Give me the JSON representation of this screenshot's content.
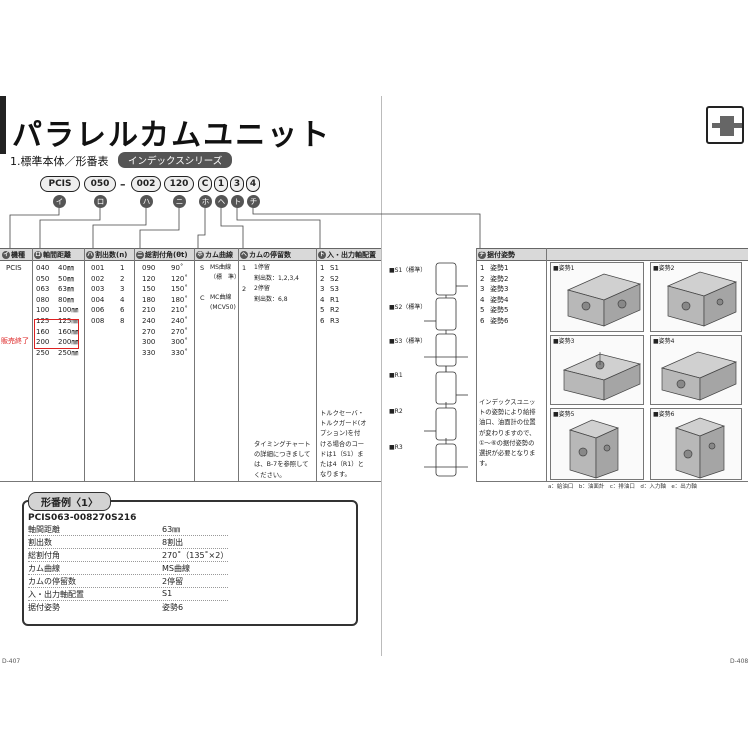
{
  "header": {
    "title": "パラレルカムユニット",
    "subtitle": "1.標準本体／形番表",
    "series_badge": "インデックスシリーズ"
  },
  "code": {
    "parts": [
      "PCIS",
      "050",
      "002",
      "120",
      "C",
      "1",
      "3",
      "4"
    ],
    "dash": "–",
    "markers": [
      "イ",
      "ロ",
      "ハ",
      "ニ",
      "ホ",
      "ヘ",
      "ト",
      "チ"
    ]
  },
  "table": {
    "headers": {
      "kind": "機種",
      "center": "軸間距離",
      "div": "割出数(n)",
      "angle": "総割付角(θt)",
      "curve": "カム曲線",
      "stops": "カムの停留数",
      "io": "入・出力軸配置",
      "mount": "据付姿勢"
    },
    "kind": "PCIS",
    "center_codes": "040\n050\n063\n080\n100\n125\n160\n200\n250",
    "center_values": "40㎜\n50㎜\n63㎜\n80㎜\n100㎜\n125㎜\n160㎜\n200㎜\n250㎜",
    "div_codes": "001\n002\n003\n004\n006\n008",
    "div_values": "1\n2\n3\n4\n6\n8",
    "angle_codes": "090\n120\n150\n180\n210\n240\n270\n300\n330",
    "angle_values": "90˚\n120˚\n150˚\n180˚\n210˚\n240˚\n270˚\n300˚\n330˚",
    "curve_codes": "S\n\n\nC",
    "curve_values": "MS曲線\n（標　準）\n\nMC曲線\n(MCV50)",
    "stop_codes": "1\n\n2",
    "stop_values": "1停留\n割出数：1,2,3,4\n2停留\n割出数：6,8",
    "stop_note": "タイミングチャート\nの詳細につきまして\nは、B-7を参照して\nください。",
    "io_codes": "1\n2\n3\n4\n5\n6",
    "io_values": "S1\nS2\nS3\nR1\nR2\nR3",
    "io_note": "トルクセーバ・\nトルクガード(オ\nプション)を付\nける場合のコー\nドは1（S1）ま\nたは4（R1）と\nなります。",
    "mount_codes": "1\n2\n3\n4\n5\n6",
    "mount_values": "姿勢1\n姿勢2\n姿勢3\n姿勢4\n姿勢5\n姿勢6",
    "mount_note": "インデックスユニッ\nトの姿勢により給排\n油口、油面計の位置\nが変わりますので、\n①～⑥の据付姿勢の\n選択が必要となりま\nす。",
    "sold_out": "販売終了"
  },
  "configs": [
    "■S1（標準）",
    "■S2（標準）",
    "■S3（標準）",
    "■R1",
    "■R2",
    "■R3"
  ],
  "postures": [
    "■姿勢1",
    "■姿勢2",
    "■姿勢3",
    "■姿勢4",
    "■姿勢5",
    "■姿勢6"
  ],
  "posture_legend": "a：給油口　b：油面計　c：排油口　d：入力軸　e：出力軸",
  "example": {
    "tab": "形番例〈1〉",
    "code": "PCIS063-008270S216",
    "rows": [
      {
        "label": "軸間距離",
        "value": "63㎜"
      },
      {
        "label": "割出数",
        "value": "8割出"
      },
      {
        "label": "総割付角",
        "value": "270˚（135˚×2）"
      },
      {
        "label": "カム曲線",
        "value": "MS曲線"
      },
      {
        "label": "カムの停留数",
        "value": "2停留"
      },
      {
        "label": "入・出力軸配置",
        "value": "S1"
      },
      {
        "label": "据付姿勢",
        "value": "姿勢6"
      }
    ]
  },
  "pages": {
    "left": "D-407",
    "right": "D-408"
  }
}
